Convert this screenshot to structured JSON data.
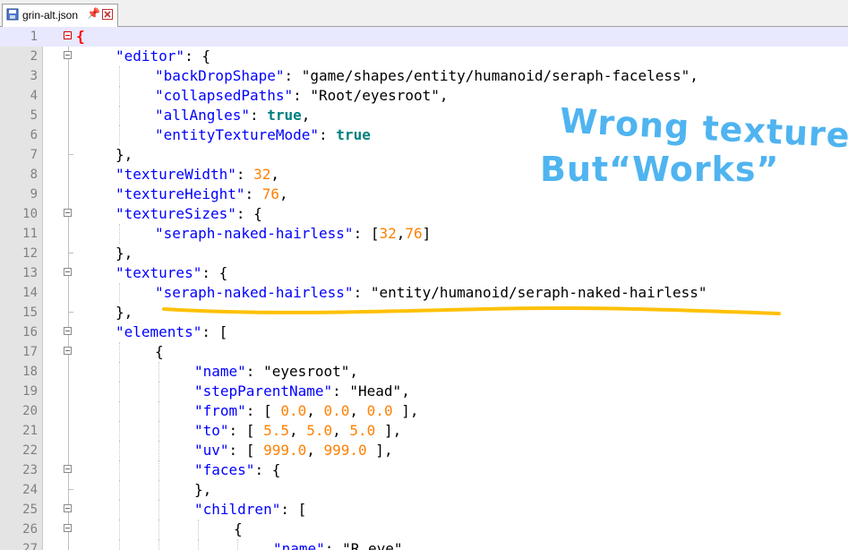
{
  "tab": {
    "filename": "grin-alt.json",
    "pin_glyph": "📌"
  },
  "annotation": {
    "line1": "Wrong texture",
    "line2": "But“Works”",
    "color": "#4fb4f0",
    "underline_color": "#ffc107"
  },
  "lines": [
    {
      "n": "1",
      "indent": 0,
      "fold": "red",
      "tokens": [
        {
          "t": "{",
          "c": "br"
        }
      ]
    },
    {
      "n": "2",
      "indent": 1,
      "fold": "box",
      "tokens": [
        {
          "t": "\"editor\"",
          "c": "k"
        },
        {
          "t": ": {",
          "c": "p"
        }
      ]
    },
    {
      "n": "3",
      "indent": 2,
      "fold": "",
      "tokens": [
        {
          "t": "\"backDropShape\"",
          "c": "k"
        },
        {
          "t": ": ",
          "c": "p"
        },
        {
          "t": "\"game/shapes/entity/humanoid/seraph-faceless\"",
          "c": "s"
        },
        {
          "t": ",",
          "c": "p"
        }
      ]
    },
    {
      "n": "4",
      "indent": 2,
      "fold": "",
      "tokens": [
        {
          "t": "\"collapsedPaths\"",
          "c": "k"
        },
        {
          "t": ": ",
          "c": "p"
        },
        {
          "t": "\"Root/eyesroot\"",
          "c": "s"
        },
        {
          "t": ",",
          "c": "p"
        }
      ]
    },
    {
      "n": "5",
      "indent": 2,
      "fold": "",
      "tokens": [
        {
          "t": "\"allAngles\"",
          "c": "k"
        },
        {
          "t": ": ",
          "c": "p"
        },
        {
          "t": "true",
          "c": "b"
        },
        {
          "t": ",",
          "c": "p"
        }
      ]
    },
    {
      "n": "6",
      "indent": 2,
      "fold": "",
      "tokens": [
        {
          "t": "\"entityTextureMode\"",
          "c": "k"
        },
        {
          "t": ": ",
          "c": "p"
        },
        {
          "t": "true",
          "c": "b"
        }
      ]
    },
    {
      "n": "7",
      "indent": 1,
      "fold": "end",
      "tokens": [
        {
          "t": "},",
          "c": "p"
        }
      ]
    },
    {
      "n": "8",
      "indent": 1,
      "fold": "",
      "tokens": [
        {
          "t": "\"textureWidth\"",
          "c": "k"
        },
        {
          "t": ": ",
          "c": "p"
        },
        {
          "t": "32",
          "c": "n"
        },
        {
          "t": ",",
          "c": "p"
        }
      ]
    },
    {
      "n": "9",
      "indent": 1,
      "fold": "",
      "tokens": [
        {
          "t": "\"textureHeight\"",
          "c": "k"
        },
        {
          "t": ": ",
          "c": "p"
        },
        {
          "t": "76",
          "c": "n"
        },
        {
          "t": ",",
          "c": "p"
        }
      ]
    },
    {
      "n": "10",
      "indent": 1,
      "fold": "box",
      "tokens": [
        {
          "t": "\"textureSizes\"",
          "c": "k"
        },
        {
          "t": ": {",
          "c": "p"
        }
      ]
    },
    {
      "n": "11",
      "indent": 2,
      "fold": "",
      "tokens": [
        {
          "t": "\"seraph-naked-hairless\"",
          "c": "k"
        },
        {
          "t": ": [",
          "c": "p"
        },
        {
          "t": "32",
          "c": "n"
        },
        {
          "t": ",",
          "c": "p"
        },
        {
          "t": "76",
          "c": "n"
        },
        {
          "t": "]",
          "c": "p"
        }
      ]
    },
    {
      "n": "12",
      "indent": 1,
      "fold": "end",
      "tokens": [
        {
          "t": "},",
          "c": "p"
        }
      ]
    },
    {
      "n": "13",
      "indent": 1,
      "fold": "box",
      "tokens": [
        {
          "t": "\"textures\"",
          "c": "k"
        },
        {
          "t": ": {",
          "c": "p"
        }
      ]
    },
    {
      "n": "14",
      "indent": 2,
      "fold": "",
      "tokens": [
        {
          "t": "\"seraph-naked-hairless\"",
          "c": "k"
        },
        {
          "t": ": ",
          "c": "p"
        },
        {
          "t": "\"entity/humanoid/seraph-naked-hairless\"",
          "c": "s"
        }
      ]
    },
    {
      "n": "15",
      "indent": 1,
      "fold": "end",
      "tokens": [
        {
          "t": "},",
          "c": "p"
        }
      ]
    },
    {
      "n": "16",
      "indent": 1,
      "fold": "box",
      "tokens": [
        {
          "t": "\"elements\"",
          "c": "k"
        },
        {
          "t": ": [",
          "c": "p"
        }
      ]
    },
    {
      "n": "17",
      "indent": 2,
      "fold": "box",
      "tokens": [
        {
          "t": "{",
          "c": "p"
        }
      ]
    },
    {
      "n": "18",
      "indent": 3,
      "fold": "",
      "tokens": [
        {
          "t": "\"name\"",
          "c": "k"
        },
        {
          "t": ": ",
          "c": "p"
        },
        {
          "t": "\"eyesroot\"",
          "c": "s"
        },
        {
          "t": ",",
          "c": "p"
        }
      ]
    },
    {
      "n": "19",
      "indent": 3,
      "fold": "",
      "tokens": [
        {
          "t": "\"stepParentName\"",
          "c": "k"
        },
        {
          "t": ": ",
          "c": "p"
        },
        {
          "t": "\"Head\"",
          "c": "s"
        },
        {
          "t": ",",
          "c": "p"
        }
      ]
    },
    {
      "n": "20",
      "indent": 3,
      "fold": "",
      "tokens": [
        {
          "t": "\"from\"",
          "c": "k"
        },
        {
          "t": ": [ ",
          "c": "p"
        },
        {
          "t": "0.0",
          "c": "n"
        },
        {
          "t": ", ",
          "c": "p"
        },
        {
          "t": "0.0",
          "c": "n"
        },
        {
          "t": ", ",
          "c": "p"
        },
        {
          "t": "0.0",
          "c": "n"
        },
        {
          "t": " ],",
          "c": "p"
        }
      ]
    },
    {
      "n": "21",
      "indent": 3,
      "fold": "",
      "tokens": [
        {
          "t": "\"to\"",
          "c": "k"
        },
        {
          "t": ": [ ",
          "c": "p"
        },
        {
          "t": "5.5",
          "c": "n"
        },
        {
          "t": ", ",
          "c": "p"
        },
        {
          "t": "5.0",
          "c": "n"
        },
        {
          "t": ", ",
          "c": "p"
        },
        {
          "t": "5.0",
          "c": "n"
        },
        {
          "t": " ],",
          "c": "p"
        }
      ]
    },
    {
      "n": "22",
      "indent": 3,
      "fold": "",
      "tokens": [
        {
          "t": "\"uv\"",
          "c": "k"
        },
        {
          "t": ": [ ",
          "c": "p"
        },
        {
          "t": "999.0",
          "c": "n"
        },
        {
          "t": ", ",
          "c": "p"
        },
        {
          "t": "999.0",
          "c": "n"
        },
        {
          "t": " ],",
          "c": "p"
        }
      ]
    },
    {
      "n": "23",
      "indent": 3,
      "fold": "box",
      "tokens": [
        {
          "t": "\"faces\"",
          "c": "k"
        },
        {
          "t": ": {",
          "c": "p"
        }
      ]
    },
    {
      "n": "24",
      "indent": 3,
      "fold": "end",
      "tokens": [
        {
          "t": "},",
          "c": "p"
        }
      ]
    },
    {
      "n": "25",
      "indent": 3,
      "fold": "box",
      "tokens": [
        {
          "t": "\"children\"",
          "c": "k"
        },
        {
          "t": ": [",
          "c": "p"
        }
      ]
    },
    {
      "n": "26",
      "indent": 4,
      "fold": "box",
      "tokens": [
        {
          "t": "{",
          "c": "p"
        }
      ]
    },
    {
      "n": "27",
      "indent": 5,
      "fold": "",
      "tokens": [
        {
          "t": "\"name\"",
          "c": "k"
        },
        {
          "t": ": ",
          "c": "p"
        },
        {
          "t": "\"R_eye\"",
          "c": "s"
        },
        {
          "t": ",",
          "c": "p"
        }
      ]
    }
  ]
}
